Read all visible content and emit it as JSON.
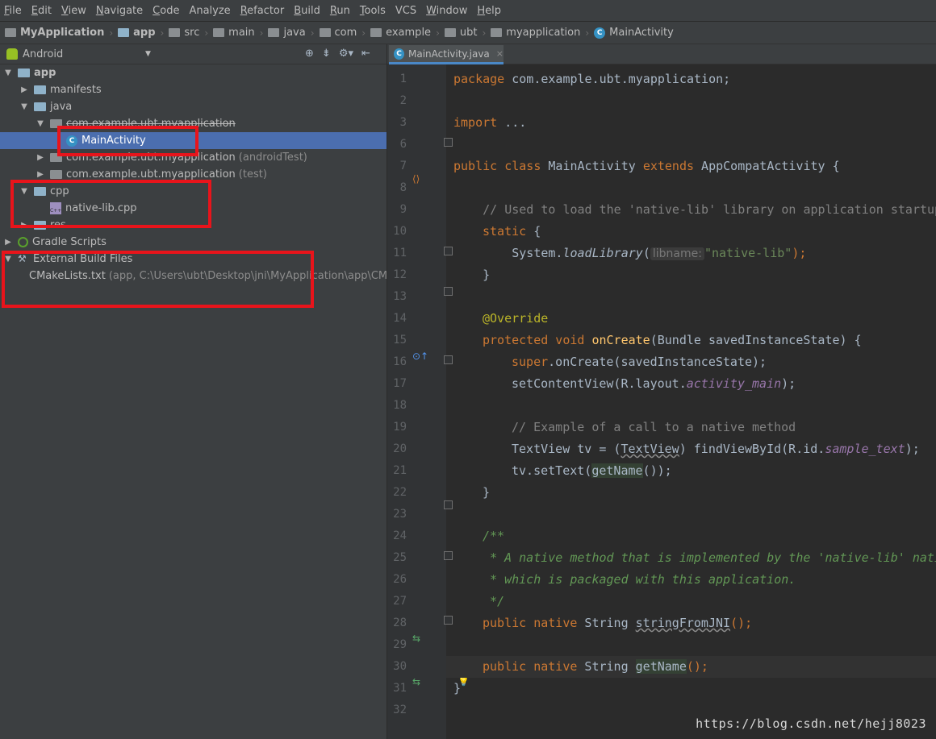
{
  "menu": [
    {
      "label": "File",
      "u": "F",
      "rest": "ile"
    },
    {
      "label": "Edit",
      "u": "E",
      "rest": "dit"
    },
    {
      "label": "View",
      "u": "V",
      "rest": "iew"
    },
    {
      "label": "Navigate",
      "u": "N",
      "rest": "avigate"
    },
    {
      "label": "Code",
      "u": "C",
      "rest": "ode"
    },
    {
      "label": "Analyze",
      "u": "",
      "rest": "Analyze"
    },
    {
      "label": "Refactor",
      "u": "R",
      "rest": "efactor"
    },
    {
      "label": "Build",
      "u": "B",
      "rest": "uild"
    },
    {
      "label": "Run",
      "u": "R",
      "rest": "un"
    },
    {
      "label": "Tools",
      "u": "T",
      "rest": "ools"
    },
    {
      "label": "VCS",
      "u": "",
      "rest": "VCS"
    },
    {
      "label": "Window",
      "u": "W",
      "rest": "indow"
    },
    {
      "label": "Help",
      "u": "H",
      "rest": "elp"
    }
  ],
  "breadcrumb": [
    {
      "label": "MyApplication",
      "bold": true,
      "icon": "folder-icon"
    },
    {
      "label": "app",
      "bold": true,
      "icon": "module-icon"
    },
    {
      "label": "src",
      "bold": false,
      "icon": "folder-icon"
    },
    {
      "label": "main",
      "bold": false,
      "icon": "folder-icon"
    },
    {
      "label": "java",
      "bold": false,
      "icon": "folder-icon"
    },
    {
      "label": "com",
      "bold": false,
      "icon": "folder-icon"
    },
    {
      "label": "example",
      "bold": false,
      "icon": "folder-icon"
    },
    {
      "label": "ubt",
      "bold": false,
      "icon": "folder-icon"
    },
    {
      "label": "myapplication",
      "bold": false,
      "icon": "folder-icon"
    },
    {
      "label": "MainActivity",
      "bold": false,
      "icon": "class-icon"
    }
  ],
  "project": {
    "view": "Android",
    "tree": [
      {
        "label": "app",
        "indent": 0,
        "toggle": "▼",
        "icon": "module",
        "bold": true
      },
      {
        "label": "manifests",
        "indent": 1,
        "toggle": "▶",
        "icon": "folder"
      },
      {
        "label": "java",
        "indent": 1,
        "toggle": "▼",
        "icon": "folder"
      },
      {
        "label": "com.example.ubt.myapplication",
        "indent": 2,
        "toggle": "▼",
        "icon": "package",
        "strike": true
      },
      {
        "label": "MainActivity",
        "indent": 3,
        "toggle": "",
        "icon": "class",
        "selected": true
      },
      {
        "label": "com.example.ubt.myapplication",
        "hint": "(androidTest)",
        "indent": 2,
        "toggle": "▶",
        "icon": "package"
      },
      {
        "label": "com.example.ubt.myapplication",
        "hint": "(test)",
        "indent": 2,
        "toggle": "▶",
        "icon": "package"
      },
      {
        "label": "cpp",
        "indent": 1,
        "toggle": "▼",
        "icon": "folder"
      },
      {
        "label": "native-lib.cpp",
        "indent": 2,
        "toggle": "",
        "icon": "cpp"
      },
      {
        "label": "res",
        "indent": 1,
        "toggle": "▶",
        "icon": "folder",
        "strike": true
      },
      {
        "label": "Gradle Scripts",
        "indent": 0,
        "toggle": "▶",
        "icon": "gradle"
      },
      {
        "label": "External Build Files",
        "indent": 0,
        "toggle": "▼",
        "icon": "tool"
      },
      {
        "label": "CMakeLists.txt",
        "hint": "(app, C:\\Users\\ubt\\Desktop\\jni\\MyApplication\\app\\CMak",
        "indent": 1,
        "toggle": "",
        "icon": "txt"
      }
    ]
  },
  "editor": {
    "tab_label": "MainActivity.java",
    "tab_close": "×",
    "line_numbers": [
      "1",
      "2",
      "3",
      "6",
      "7",
      "8",
      "9",
      "10",
      "11",
      "12",
      "13",
      "14",
      "15",
      "16",
      "17",
      "18",
      "19",
      "20",
      "21",
      "22",
      "23",
      "24",
      "25",
      "26",
      "27",
      "28",
      "29",
      "30",
      "31",
      "32"
    ],
    "code": {
      "l1_kw": "package",
      "l1_rest": " com.example.ubt.myapplication;",
      "l3_kw": "import",
      "l3_rest": " ...",
      "l7_kw1": "public class",
      "l7_mid": " MainActivity ",
      "l7_kw2": "extends",
      "l7_rest": " AppCompatActivity {",
      "l9": "    // Used to load the 'native-lib' library on application startup.",
      "l10_kw": "static",
      "l10_rest": " {",
      "l11_a": "        System.",
      "l11_fn": "loadLibrary",
      "l11_b": "(",
      "l11_hint": "libname:",
      "l11_str": "\"native-lib\"",
      "l11_c": ");",
      "l12": "    }",
      "l14": "@Override",
      "l15_kw": "protected void",
      "l15_fn": " onCreate",
      "l15_rest": "(Bundle savedInstanceState) {",
      "l16_kw": "super",
      "l16_rest": ".onCreate(savedInstanceState);",
      "l17_a": "setContentView(R.layout.",
      "l17_pu": "activity_main",
      "l17_b": ");",
      "l19": "// Example of a call to a native method",
      "l20_a": "TextView tv = (",
      "l20_w": "TextView",
      "l20_b": ") findViewById(R.id.",
      "l20_pu": "sample_text",
      "l20_c": ");",
      "l21_a": "tv.setText(",
      "l21_u": "getName",
      "l21_b": "());",
      "l22": "}",
      "l24": "/**",
      "l25": " * A native method that is implemented by the 'native-lib' native library,",
      "l26": " * which is packaged with this application.",
      "l27": " */",
      "l28_kw": "public native",
      "l28_mid": " String ",
      "l28_w": "stringFromJNI",
      "l28_rest": "();",
      "l30_kw": "public native",
      "l30_mid": " String ",
      "l30_u": "getName",
      "l30_rest": "();",
      "l31": "}"
    }
  },
  "watermark": "https://blog.csdn.net/hejj8023",
  "colors": {
    "selection": "#4b6eaf",
    "highlight_box": "#e8141b",
    "keyword": "#cc7832"
  }
}
